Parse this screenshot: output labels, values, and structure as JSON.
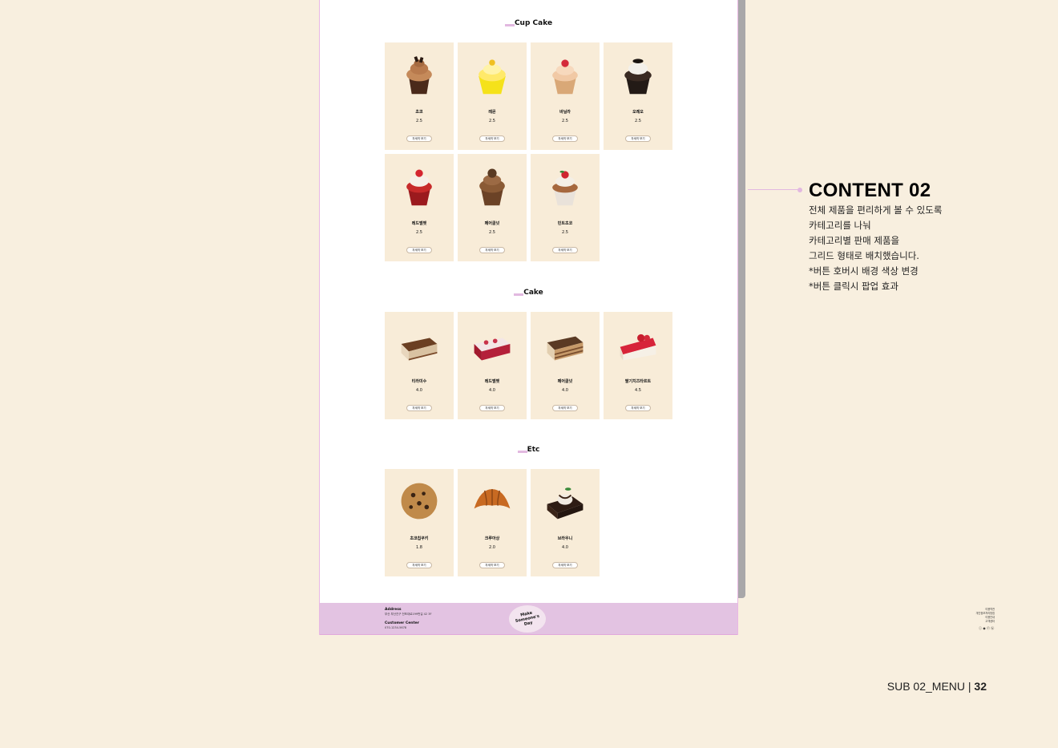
{
  "sections": {
    "cupcake": {
      "title": "Cup Cake",
      "items": [
        {
          "name": "초코",
          "price": "2.5",
          "button": "자세히 보기"
        },
        {
          "name": "레몬",
          "price": "2.5",
          "button": "자세히 보기"
        },
        {
          "name": "바닐라",
          "price": "2.5",
          "button": "자세히 보기"
        },
        {
          "name": "오레오",
          "price": "2.5",
          "button": "자세히 보기"
        },
        {
          "name": "레드벨벳",
          "price": "2.5",
          "button": "자세히 보기"
        },
        {
          "name": "페어클넛",
          "price": "2.5",
          "button": "자세히 보기"
        },
        {
          "name": "민트초코",
          "price": "2.5",
          "button": "자세히 보기"
        }
      ]
    },
    "cake": {
      "title": "Cake",
      "items": [
        {
          "name": "티라미수",
          "price": "4.0",
          "button": "자세히 보기"
        },
        {
          "name": "레드벨벳",
          "price": "4.0",
          "button": "자세히 보기"
        },
        {
          "name": "페어클넛",
          "price": "4.0",
          "button": "자세히 보기"
        },
        {
          "name": "딸기치즈타르트",
          "price": "4.5",
          "button": "자세히 보기"
        }
      ]
    },
    "etc": {
      "title": "Etc",
      "items": [
        {
          "name": "초코칩쿠키",
          "price": "1.8",
          "button": "자세히 보기"
        },
        {
          "name": "크루아상",
          "price": "2.0",
          "button": "자세히 보기"
        },
        {
          "name": "브라우니",
          "price": "4.0",
          "button": "자세히 보기"
        }
      ]
    }
  },
  "footer": {
    "address_label": "Address",
    "address_text": "부산 부산진구 전포대로199번길 42 3F",
    "center_label": "Customer Center",
    "center_phone": "070-1234-5678",
    "logo_text": "Make Someone's Day",
    "links": [
      "이용약관",
      "개인정보처리방침",
      "이용안내",
      "고객센터"
    ],
    "sns": "ⓘ ◉ ⓕ ⓑ"
  },
  "annotation": {
    "title": "CONTENT 02",
    "lines": [
      "전체 제품을 편리하게 볼 수 있도록",
      "카테고리를 나눠",
      "카테고리별 판매 제품을",
      "그리드 형태로 배치했습니다.",
      "*버튼 호버시 배경 색상 변경",
      "*버튼 클릭시 팝업 효과"
    ]
  },
  "page_label": {
    "text": "SUB 02_MENU | ",
    "number": "32"
  },
  "colors": {
    "background": "#f8efdf",
    "card": "#f8ecd8",
    "accent": "#e2b9e0",
    "footer": "#e3c3e2"
  }
}
